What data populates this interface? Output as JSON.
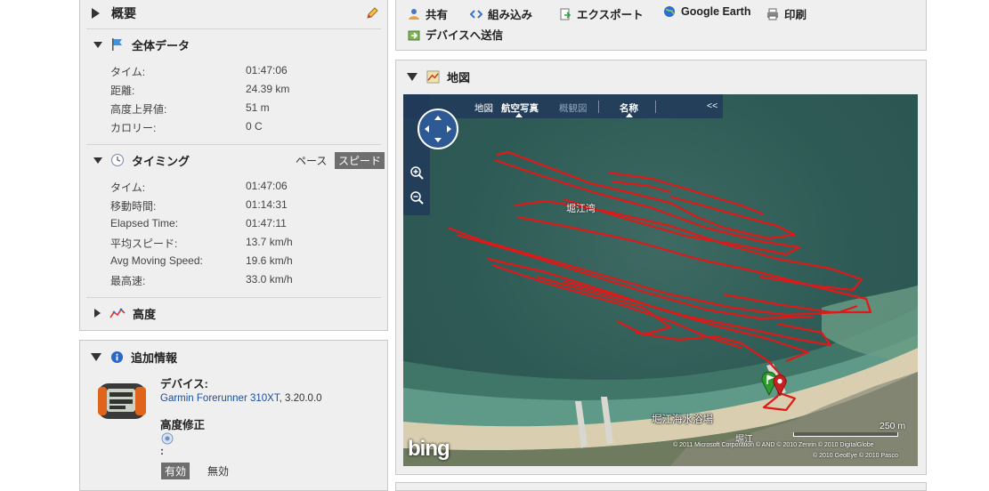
{
  "summary": {
    "title": "概要"
  },
  "overall": {
    "title": "全体データ",
    "rows": [
      {
        "label": "タイム:",
        "value": "01:47:06"
      },
      {
        "label": "距離:",
        "value": "24.39 km"
      },
      {
        "label": "高度上昇値:",
        "value": "51 m"
      },
      {
        "label": "カロリー:",
        "value": "0 C"
      }
    ]
  },
  "timing": {
    "title": "タイミング",
    "toggle_pace": "ペース",
    "toggle_speed": "スピード",
    "rows": [
      {
        "label": "タイム:",
        "value": "01:47:06"
      },
      {
        "label": "移動時間:",
        "value": "01:14:31"
      },
      {
        "label": "Elapsed Time:",
        "value": "01:47:11"
      },
      {
        "label": "平均スピード:",
        "value": "13.7 km/h"
      },
      {
        "label": "Avg Moving Speed:",
        "value": "19.6 km/h"
      },
      {
        "label": "最高速:",
        "value": "33.0 km/h"
      }
    ]
  },
  "elevation": {
    "title": "高度"
  },
  "extra": {
    "title": "追加情報",
    "device_label": "デバイス:",
    "device_name": "Garmin Forerunner 310XT",
    "device_version": ", 3.20.0.0",
    "elev_corr_label": "高度修正",
    "elev_corr_colon": ":",
    "enabled": "有効",
    "disabled": "無効"
  },
  "toolbar": {
    "share": "共有",
    "embed": "組み込み",
    "export": "エクスポート",
    "google_earth": "Google Earth",
    "print": "印刷",
    "send_device": "デバイスへ送信"
  },
  "map": {
    "title": "地図",
    "nav_map": "地図",
    "nav_aerial": "航空写真",
    "nav_bird": "概観図",
    "nav_labels": "名称",
    "nav_collapse": "<<",
    "label_bay": "堀江湾",
    "label_beach": "堀江海水浴場",
    "label_small": "堀江",
    "scale": "250 m",
    "copyright": "© 2011 Microsoft Corporation  © AND  © 2010 Zenrin  © 2010 DigitalGlobe",
    "copyright2": "© 2010 GeoEye  © 2010 Pasco",
    "logo": "bing"
  },
  "colors": {
    "track": "#e01818",
    "accent_link": "#1a4fa0"
  }
}
